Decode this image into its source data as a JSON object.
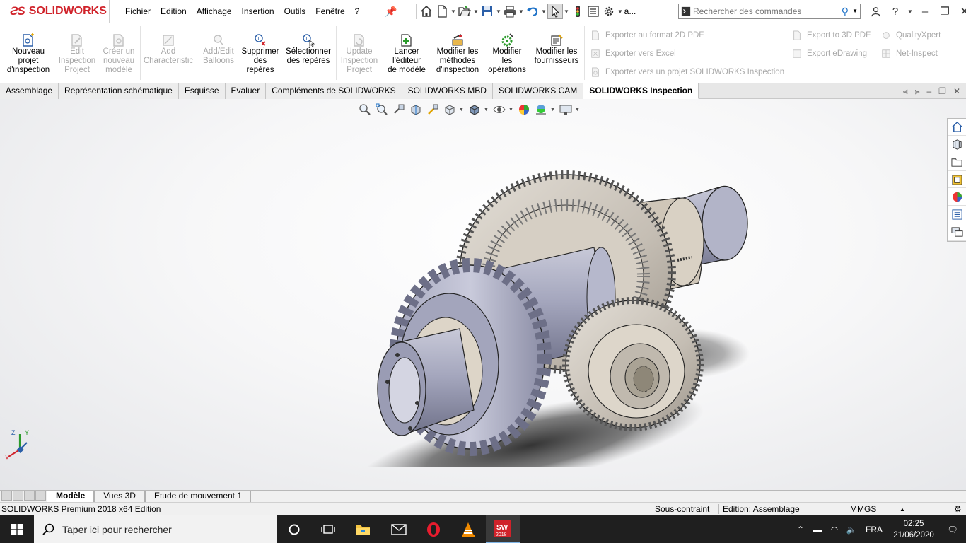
{
  "app": {
    "brand": "SOLIDWORKS",
    "menu": [
      "Fichier",
      "Edition",
      "Affichage",
      "Insertion",
      "Outils",
      "Fenêtre",
      "?"
    ],
    "quick_access_overflow": "a...",
    "search_placeholder": "Rechercher des commandes"
  },
  "ribbon": {
    "buttons": [
      {
        "label": "Nouveau\nprojet\nd'inspection",
        "enabled": true
      },
      {
        "label": "Edit\nInspection\nProject",
        "enabled": false
      },
      {
        "label": "Créer un\nnouveau\nmodèle",
        "enabled": false
      },
      {
        "label": "Add\nCharacteristic",
        "enabled": false
      },
      {
        "label": "Add/Edit\nBalloons",
        "enabled": false
      },
      {
        "label": "Supprimer\ndes\nrepères",
        "enabled": true
      },
      {
        "label": "Sélectionner\ndes repères",
        "enabled": true
      },
      {
        "label": "Update\nInspection\nProject",
        "enabled": false
      },
      {
        "label": "Lancer\nl'éditeur\nde modèle",
        "enabled": true
      },
      {
        "label": "Modifier les\nméthodes\nd'inspection",
        "enabled": true
      },
      {
        "label": "Modifier\nles\nopérations",
        "enabled": true
      },
      {
        "label": "Modifier les\nfournisseurs",
        "enabled": true
      }
    ],
    "export_items": [
      "Exporter au format 2D PDF",
      "Exporter vers Excel",
      "Exporter vers un projet SOLIDWORKS Inspection",
      "Export to 3D PDF",
      "Export eDrawing",
      "QualityXpert",
      "Net-Inspect"
    ]
  },
  "tabs": [
    {
      "label": "Assemblage",
      "active": false
    },
    {
      "label": "Représentation schématique",
      "active": false
    },
    {
      "label": "Esquisse",
      "active": false
    },
    {
      "label": "Evaluer",
      "active": false
    },
    {
      "label": "Compléments de SOLIDWORKS",
      "active": false
    },
    {
      "label": "SOLIDWORKS MBD",
      "active": false
    },
    {
      "label": "SOLIDWORKS CAM",
      "active": false
    },
    {
      "label": "SOLIDWORKS Inspection",
      "active": true
    }
  ],
  "triad": {
    "x": "X",
    "y": "Y",
    "z": "Z"
  },
  "bottom_tabs": [
    {
      "label": "Modèle",
      "active": true
    },
    {
      "label": "Vues 3D",
      "active": false
    },
    {
      "label": "Etude de mouvement 1",
      "active": false
    }
  ],
  "status": {
    "edition": "SOLIDWORKS Premium 2018 x64 Edition",
    "constraint": "Sous-contraint",
    "mode": "Edition: Assemblage",
    "units": "MMGS"
  },
  "taskbar": {
    "search_placeholder": "Taper ici pour rechercher",
    "app_badge": "2018",
    "lang": "FRA",
    "time": "02:25",
    "date": "21/06/2020"
  },
  "colors": {
    "brand_red": "#d0222a",
    "accent_blue": "#1e72c8",
    "gear": "#cbc5bc",
    "shaft": "#a4a6bd"
  }
}
